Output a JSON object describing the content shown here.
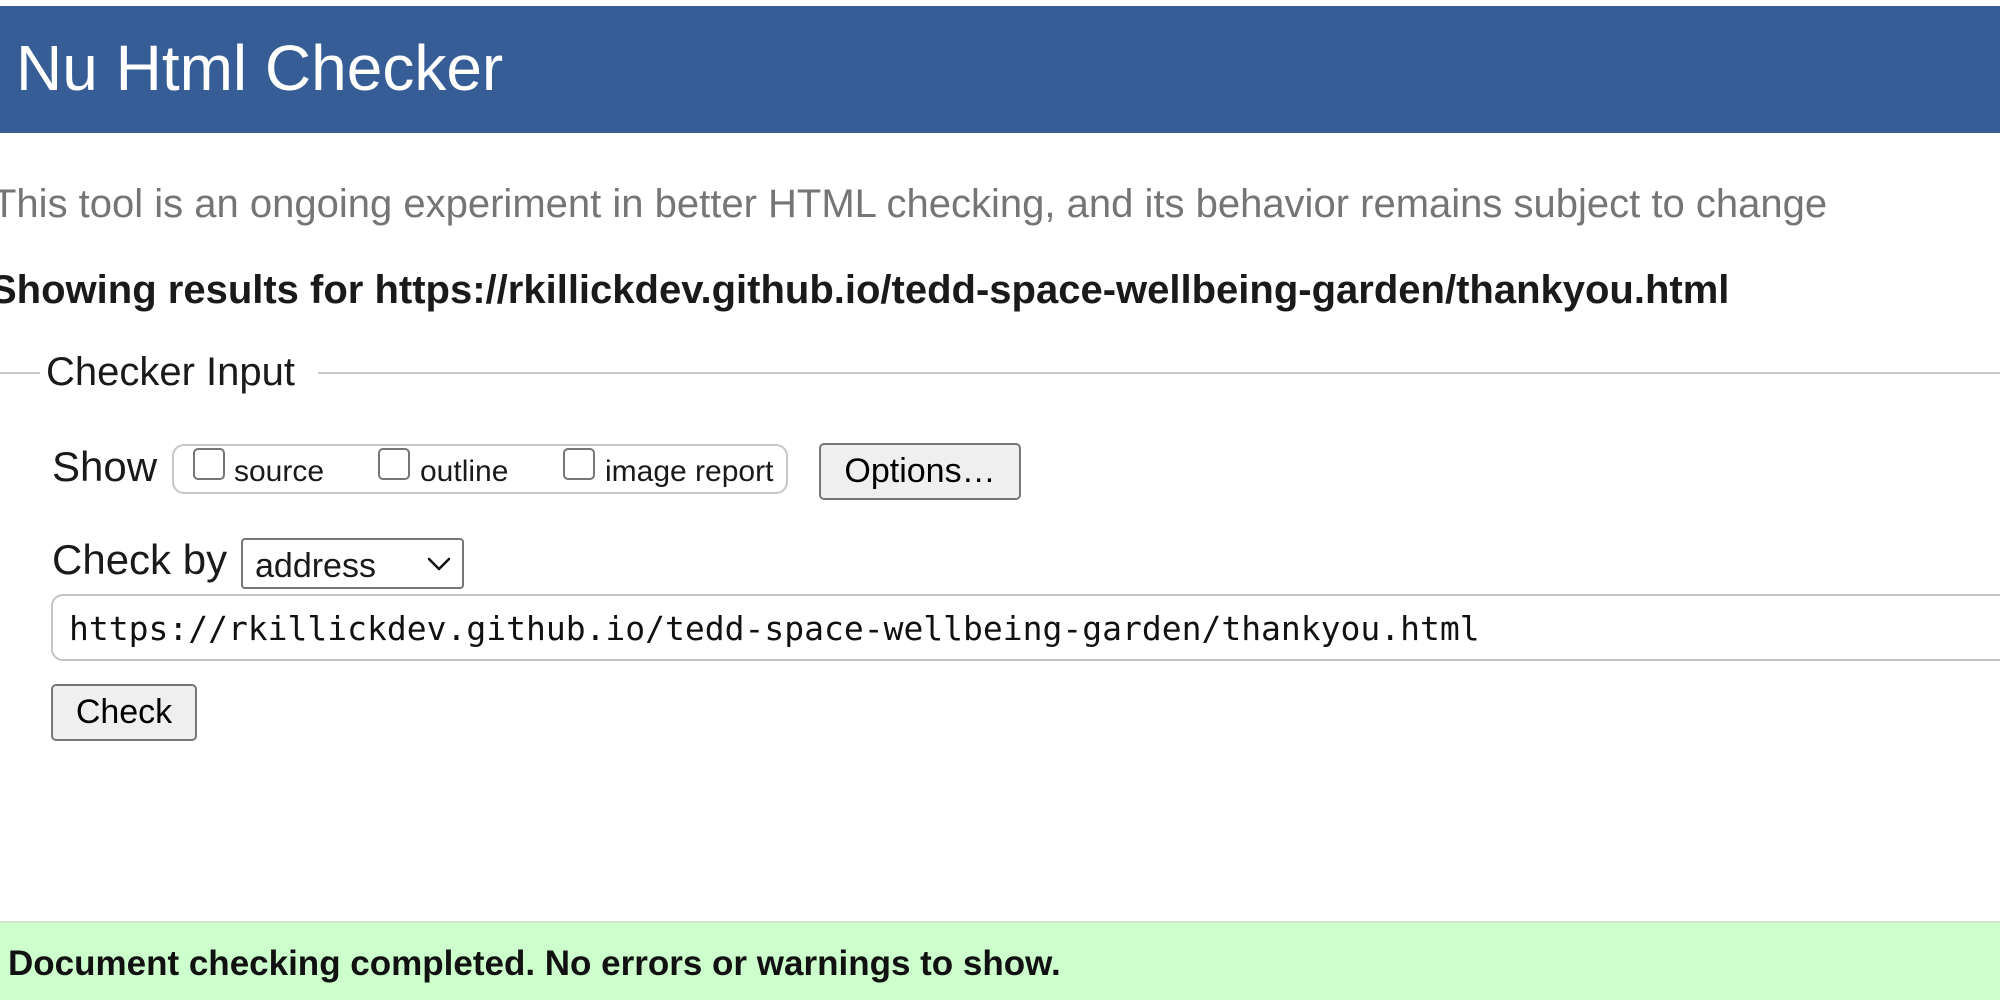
{
  "header": {
    "title": "Nu Html Checker",
    "background_color": "#365d95"
  },
  "tagline": "This tool is an ongoing experiment in better HTML checking, and its behavior remains subject to change",
  "results_heading": "Showing results for https://rkillickdev.github.io/tedd-space-wellbeing-garden/thankyou.html",
  "checker_input": {
    "legend": "Checker Input",
    "show_label": "Show",
    "show_options": [
      {
        "label": "source",
        "checked": false
      },
      {
        "label": "outline",
        "checked": false
      },
      {
        "label": "image report",
        "checked": false
      }
    ],
    "options_button": "Options…",
    "check_by_label": "Check by",
    "check_by_value": "address",
    "url_value": "https://rkillickdev.github.io/tedd-space-wellbeing-garden/thankyou.html",
    "check_button": "Check"
  },
  "status": {
    "message": "Document checking completed. No errors or warnings to show.",
    "background_color": "#ccffcc"
  },
  "icons": {
    "checkbox": "empty-checkbox-icon",
    "select_chevron": "chevron-down-icon"
  }
}
